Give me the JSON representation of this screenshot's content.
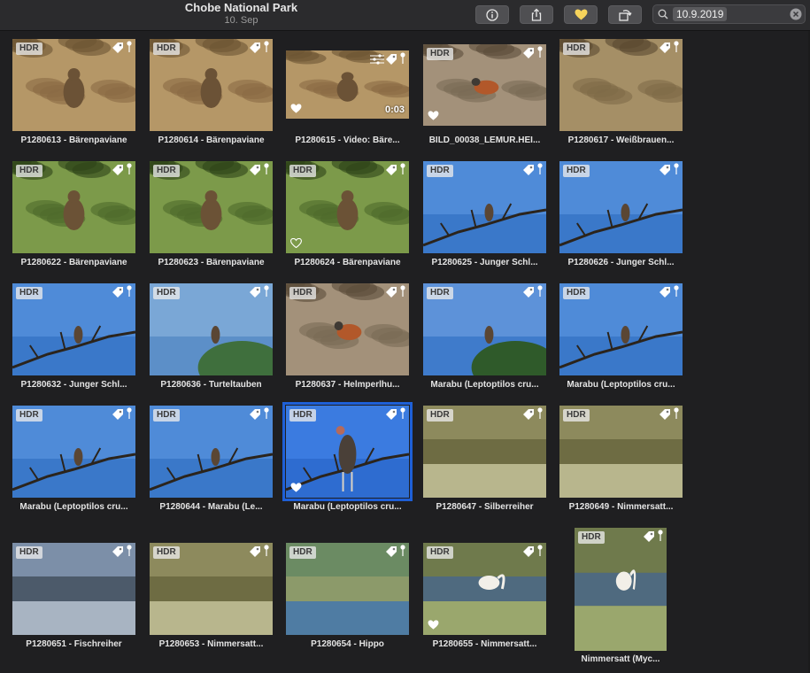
{
  "window": {
    "title": "Chobe National Park",
    "subtitle": "10. Sep"
  },
  "toolbar": {
    "buttons": [
      {
        "name": "info-button",
        "icon": "info-icon"
      },
      {
        "name": "share-button",
        "icon": "share-icon"
      },
      {
        "name": "favorite-button",
        "icon": "heart-icon"
      },
      {
        "name": "rotate-button",
        "icon": "rotate-icon"
      }
    ],
    "search": {
      "token": "10.9.2019",
      "icon": "search-icon"
    }
  },
  "photos": [
    {
      "caption": "P1280613 - Bärenpaviane",
      "hdr": "HDR",
      "fav": false,
      "scene": "savanna"
    },
    {
      "caption": "P1280614 - Bärenpaviane",
      "hdr": "HDR",
      "fav": false,
      "scene": "savanna"
    },
    {
      "caption": "P1280615 - Video: Bäre...",
      "hdr": "",
      "fav": true,
      "duration": "0:03",
      "scene": "savanna"
    },
    {
      "caption": "BILD_00038_LEMUR.HEI...",
      "hdr": "HDR",
      "fav": true,
      "scene": "ground"
    },
    {
      "caption": "P1280617 - Weißbrauen...",
      "hdr": "HDR",
      "fav": false,
      "scene": "dry"
    },
    {
      "caption": "P1280622 - Bärenpaviane",
      "hdr": "HDR",
      "fav": false,
      "scene": "trees"
    },
    {
      "caption": "P1280623 - Bärenpaviane",
      "hdr": "HDR",
      "fav": false,
      "scene": "trees"
    },
    {
      "caption": "P1280624 - Bärenpaviane",
      "hdr": "HDR",
      "fav": true,
      "favOutline": true,
      "scene": "trees"
    },
    {
      "caption": "P1280625 - Junger Schl...",
      "hdr": "HDR",
      "fav": false,
      "scene": "sky-branch"
    },
    {
      "caption": "P1280626 - Junger Schl...",
      "hdr": "HDR",
      "fav": false,
      "scene": "sky-branch"
    },
    {
      "caption": "P1280632 - Junger Schl...",
      "hdr": "HDR",
      "fav": false,
      "scene": "sky-branch"
    },
    {
      "caption": "P1280636 - Turteltauben",
      "hdr": "HDR",
      "fav": false,
      "scene": "sky-tree"
    },
    {
      "caption": "P1280637 - Helmperlhu...",
      "hdr": "HDR",
      "fav": false,
      "scene": "ground"
    },
    {
      "caption": "Marabu (Leptoptilos cru...",
      "hdr": "HDR",
      "fav": false,
      "scene": "sky-bush"
    },
    {
      "caption": "Marabu (Leptoptilos cru...",
      "hdr": "HDR",
      "fav": false,
      "scene": "sky-branch"
    },
    {
      "caption": "Marabu (Leptoptilos cru...",
      "hdr": "HDR",
      "fav": false,
      "scene": "sky-branch"
    },
    {
      "caption": "P1280644 - Marabu (Le...",
      "hdr": "HDR",
      "fav": false,
      "scene": "sky-branch"
    },
    {
      "caption": "Marabu (Leptoptilos cru...",
      "hdr": "HDR",
      "fav": true,
      "selected": true,
      "scene": "sky-stork"
    },
    {
      "caption": "P1280647 - Silberreiher",
      "hdr": "HDR",
      "fav": false,
      "scene": "grass-water"
    },
    {
      "caption": "P1280649 - Nimmersatt...",
      "hdr": "HDR",
      "fav": false,
      "scene": "grass-water"
    },
    {
      "caption": "P1280651 - Fischreiher",
      "hdr": "HDR",
      "fav": false,
      "scene": "shore"
    },
    {
      "caption": "P1280653 - Nimmersatt...",
      "hdr": "HDR",
      "fav": false,
      "scene": "grass-water"
    },
    {
      "caption": "P1280654 - Hippo",
      "hdr": "HDR",
      "fav": false,
      "scene": "river"
    },
    {
      "caption": "P1280655 - Nimmersatt...",
      "hdr": "HDR",
      "fav": true,
      "scene": "stork-water"
    },
    {
      "caption": "Nimmersatt (Myc...",
      "hdr": "HDR",
      "fav": false,
      "scene": "stork-water",
      "portrait": true
    }
  ],
  "colors": {
    "selection": "#1e5fd6",
    "background": "#1f1f21",
    "favorite": "#f6d35b"
  }
}
